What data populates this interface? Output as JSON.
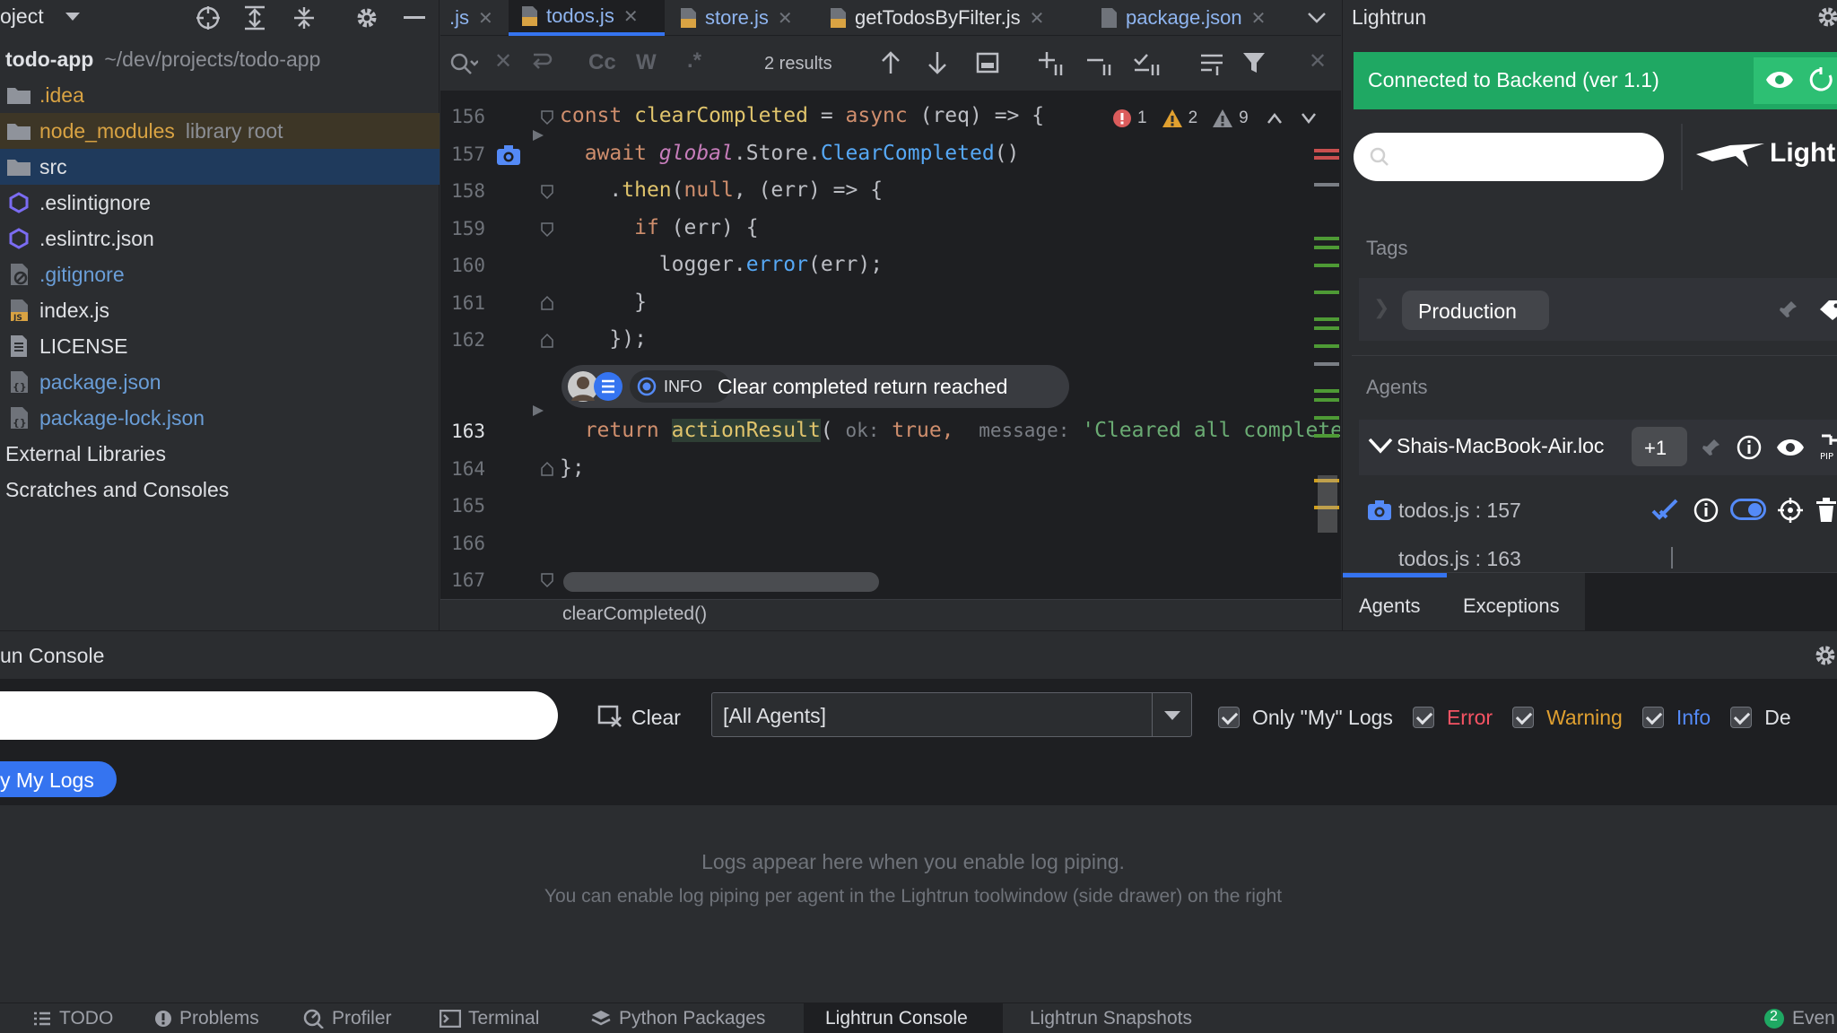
{
  "project": {
    "header_label": "oject",
    "root_name": "todo-app",
    "root_path": "~/dev/projects/todo-app",
    "items": [
      {
        "label": ".idea",
        "sub": ""
      },
      {
        "label": "node_modules",
        "sub": "library root"
      },
      {
        "label": "src",
        "sub": ""
      },
      {
        "label": ".eslintignore",
        "sub": ""
      },
      {
        "label": ".eslintrc.json",
        "sub": ""
      },
      {
        "label": ".gitignore",
        "sub": ""
      },
      {
        "label": "index.js",
        "sub": ""
      },
      {
        "label": "LICENSE",
        "sub": ""
      },
      {
        "label": "package.json",
        "sub": ""
      },
      {
        "label": "package-lock.json",
        "sub": ""
      },
      {
        "label": "External Libraries",
        "sub": ""
      },
      {
        "label": "Scratches and Consoles",
        "sub": ""
      }
    ]
  },
  "tabs": [
    {
      "label": ".js"
    },
    {
      "label": "todos.js"
    },
    {
      "label": "store.js"
    },
    {
      "label": "getTodosByFilter.js"
    },
    {
      "label": "package.json"
    }
  ],
  "find": {
    "results": "2 results",
    "case_label": "Cc",
    "word_label": "W",
    "regex_label": ".*"
  },
  "editor": {
    "line_numbers": [
      "156",
      "157",
      "158",
      "159",
      "160",
      "161",
      "162",
      "163",
      "164",
      "165",
      "166",
      "167"
    ],
    "inspections": {
      "errors": "1",
      "warnings": "2",
      "weak": "9"
    },
    "code": {
      "l156_a": "const ",
      "l156_b": "clearCompleted",
      "l156_c": " = ",
      "l156_d": "async",
      "l156_e": " (req) => {",
      "l157_a": "  await ",
      "l157_b": "global",
      "l157_c": ".Store.",
      "l157_d": "ClearCompleted",
      "l157_e": "()",
      "l158_a": "    .",
      "l158_b": "then",
      "l158_c": "(",
      "l158_d": "null",
      "l158_e": ", (err) => {",
      "l159_a": "      ",
      "l159_b": "if",
      "l159_c": " (err) {",
      "l160_a": "        logger.",
      "l160_b": "error",
      "l160_c": "(err);",
      "l161": "      }",
      "l162": "    });",
      "l163_a": "  return ",
      "l163_b": "actionResult",
      "l163_c": "( ",
      "l163_hint1": "ok:",
      "l163_d": " true,  ",
      "l163_hint2": "message:",
      "l163_e": " 'Cleared all complete",
      "l164": "};"
    },
    "log_popup": {
      "level": "INFO",
      "message": "Clear completed return reached"
    },
    "breadcrumb": "clearCompleted()"
  },
  "lightrun": {
    "title": "Lightrun",
    "status": "Connected to Backend (ver 1.1)",
    "logo_text": "Lightr",
    "tags_label": "Tags",
    "tag": "Production",
    "agents_label": "Agents",
    "agent_name": "Shais-MacBook-Air.loc",
    "agent_badge": "+1",
    "actions": [
      "todos.js : 157",
      "todos.js : 163"
    ],
    "tabs": [
      "Agents",
      "Exceptions"
    ]
  },
  "console": {
    "title": "un Console",
    "clear_label": "Clear",
    "agent_select": "[All Agents]",
    "filters": [
      {
        "label": "Only \"My\" Logs",
        "color": "#dfe1e5"
      },
      {
        "label": "Error",
        "color": "#f75464"
      },
      {
        "label": "Warning",
        "color": "#e0a030"
      },
      {
        "label": "Info",
        "color": "#548af7"
      },
      {
        "label": "De",
        "color": "#dfe1e5"
      }
    ],
    "my_logs_button": "y My Logs",
    "empty_line1": "Logs appear here when you enable log piping.",
    "empty_line2": "You can enable log piping per agent in the Lightrun toolwindow (side drawer) on the right"
  },
  "bottom_tabs": [
    {
      "label": "TODO"
    },
    {
      "label": "Problems"
    },
    {
      "label": "Profiler"
    },
    {
      "label": "Terminal"
    },
    {
      "label": "Python Packages"
    },
    {
      "label": "Lightrun Console"
    },
    {
      "label": "Lightrun Snapshots"
    }
  ],
  "event_log": {
    "count": "2",
    "label": "Even"
  }
}
